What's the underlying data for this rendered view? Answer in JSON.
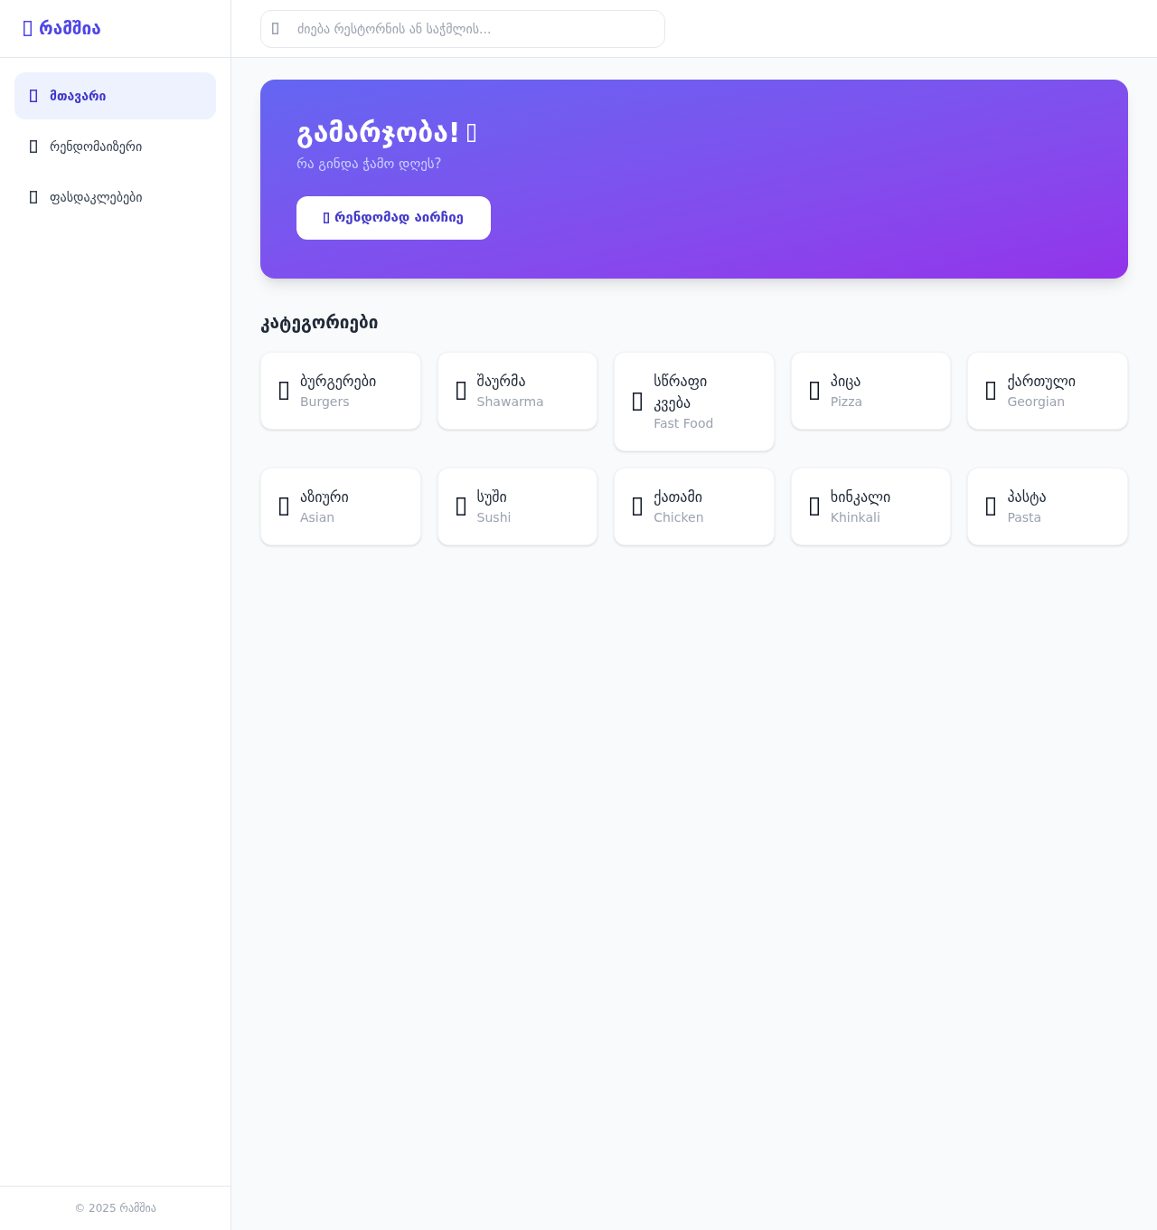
{
  "brand": {
    "name": "რამშია"
  },
  "sidebar": {
    "items": [
      {
        "label": "მთავარი",
        "selected": true
      },
      {
        "label": "რენდომაიზერი",
        "selected": false
      },
      {
        "label": "ფასდაკლებები",
        "selected": false
      }
    ],
    "footer": "© 2025 რამშია"
  },
  "search": {
    "placeholder": "ძიება რესტორნის ან საჭმლის..."
  },
  "hero": {
    "title": "გამარჯობა!",
    "subtitle": "რა გინდა ჭამო დღეს?",
    "button": "რენდომად აირჩიე"
  },
  "categories": {
    "title": "კატეგორიები",
    "items": [
      {
        "name": "ბურგერები",
        "subtitle": "Burgers"
      },
      {
        "name": "შაურმა",
        "subtitle": "Shawarma"
      },
      {
        "name": "სწრაფი კვება",
        "subtitle": "Fast Food"
      },
      {
        "name": "პიცა",
        "subtitle": "Pizza"
      },
      {
        "name": "ქართული",
        "subtitle": "Georgian"
      },
      {
        "name": "აზიური",
        "subtitle": "Asian"
      },
      {
        "name": "სუში",
        "subtitle": "Sushi"
      },
      {
        "name": "ქათამი",
        "subtitle": "Chicken"
      },
      {
        "name": "ხინკალი",
        "subtitle": "Khinkali"
      },
      {
        "name": "პასტა",
        "subtitle": "Pasta"
      }
    ]
  }
}
